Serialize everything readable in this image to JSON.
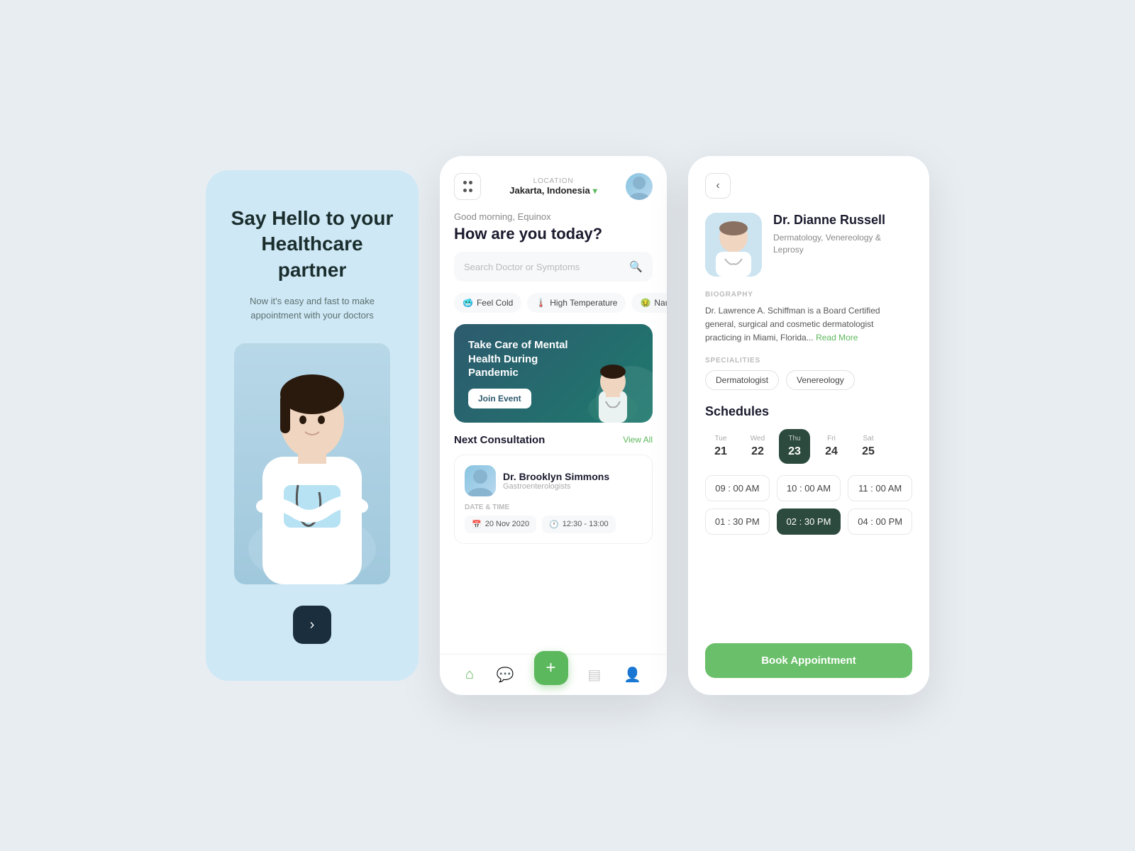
{
  "welcome": {
    "title_line1": "Say Hello to your",
    "title_line2": "Healthcare partner",
    "subtitle": "Now it's easy and fast to make appointment with your doctors",
    "next_label": "›"
  },
  "home": {
    "location_label": "LOCATION",
    "location_value": "Jakarta, Indonesia",
    "greeting_sub": "Good morning, Equinox",
    "greeting_main": "How are you today?",
    "search_placeholder": "Search Doctor or Symptoms",
    "symptoms": [
      {
        "emoji": "🥶",
        "label": "Feel Cold"
      },
      {
        "emoji": "🌡️",
        "label": "High Temperature"
      },
      {
        "emoji": "🤢",
        "label": "Nausea"
      }
    ],
    "banner": {
      "title": "Take Care of Mental Health During Pandemic",
      "btn_label": "Join Event"
    },
    "next_consultation": {
      "title": "Next Consultation",
      "view_all": "View All",
      "card": {
        "doctor_name": "Dr. Brooklyn Simmons",
        "specialty": "Gastroenterologists",
        "date_label": "DATE & TIME",
        "date": "20 Nov 2020",
        "time": "12:30 - 13:00"
      }
    }
  },
  "detail": {
    "back_label": "‹",
    "doctor_name": "Dr. Dianne Russell",
    "doctor_specialty": "Dermatology,  Venereology & Leprosy",
    "bio_label": "BIOGRAPHY",
    "bio_text": "Dr. Lawrence A. Schiffman is a Board Certified general, surgical and cosmetic dermatologist practicing in Miami, Florida...",
    "read_more": "Read More",
    "specialities_label": "SPECIALITIES",
    "specialities": [
      "Dermatologist",
      "Venereology"
    ],
    "schedules_label": "Schedules",
    "days": [
      {
        "name": "Tue",
        "num": "21",
        "active": false
      },
      {
        "name": "Wed",
        "num": "22",
        "active": false
      },
      {
        "name": "Thu",
        "num": "23",
        "active": true
      },
      {
        "name": "Fri",
        "num": "24",
        "active": false
      },
      {
        "name": "Sat",
        "num": "25",
        "active": false
      }
    ],
    "times": [
      {
        "label": "09 : 00 AM",
        "active": false
      },
      {
        "label": "10 : 00 AM",
        "active": false
      },
      {
        "label": "11 : 00 AM",
        "active": false
      },
      {
        "label": "01 : 30 PM",
        "active": false
      },
      {
        "label": "02 : 30 PM",
        "active": true
      },
      {
        "label": "04 : 00 PM",
        "active": false
      }
    ],
    "book_btn": "Book Appointment"
  }
}
